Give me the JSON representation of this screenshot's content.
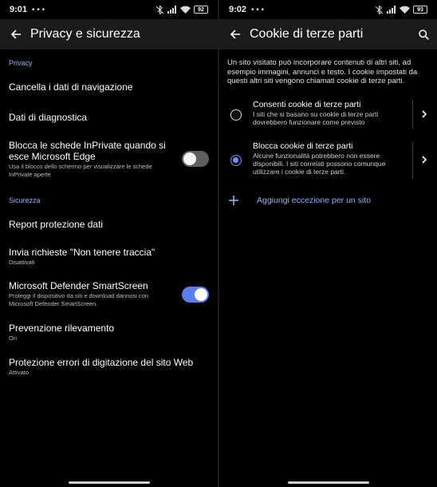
{
  "left": {
    "status": {
      "time": "9:01",
      "mini": "• • •",
      "battery": "92"
    },
    "appbar": {
      "title": "Privacy e sicurezza"
    },
    "privacy_header": "Privacy",
    "items": [
      {
        "title": "Cancella i dati di navigazione"
      },
      {
        "title": "Dati di diagnostica"
      },
      {
        "title": "Blocca le schede InPrivate quando si esce Microsoft Edge",
        "subtitle": "Usa il blocco dello schermo per visualizzare le schede InPrivate aperte",
        "toggle": false
      }
    ],
    "security_header": "Sicurezza",
    "security_items": [
      {
        "title": "Report protezione dati"
      },
      {
        "title": "Invia richieste \"Non tenere traccia\"",
        "subtitle": "Disattivati"
      },
      {
        "title": "Microsoft Defender SmartScreen",
        "subtitle": "Proteggi il dispositivo da siti e download dannosi con Microsoft Defender SmartScreen.",
        "toggle": true
      },
      {
        "title": "Prevenzione rilevamento",
        "subtitle": "On"
      },
      {
        "title": "Protezione errori di digitazione del sito Web",
        "subtitle": "Attivato"
      }
    ]
  },
  "right": {
    "status": {
      "time": "9:02",
      "mini": "• • •",
      "battery": "93"
    },
    "appbar": {
      "title": "Cookie di terze parti"
    },
    "description": "Un sito visitato può incorporare contenuti di altri siti, ad esempio immagini, annunci e testo. I cookie impostati da questi altri siti vengono chiamati cookie di terze parti.",
    "options": [
      {
        "title": "Consenti cookie di terze parti",
        "subtitle": "I siti che si basano su cookie di terze parti dovrebbero funzionare come previsto",
        "selected": false
      },
      {
        "title": "Blocca cookie di terze parti",
        "subtitle": "Alcune funzionalità potrebbero non essere disponibili. I siti correlati possono comunque utilizzare i cookie di terze parti.",
        "selected": true
      }
    ],
    "add_exception": "Aggiungi eccezione per un sito"
  },
  "colors": {
    "accent": "#8ab4f8",
    "toggle_on": "#5a7ef2",
    "appbar": "#1b1b1b",
    "background": "#000000"
  }
}
